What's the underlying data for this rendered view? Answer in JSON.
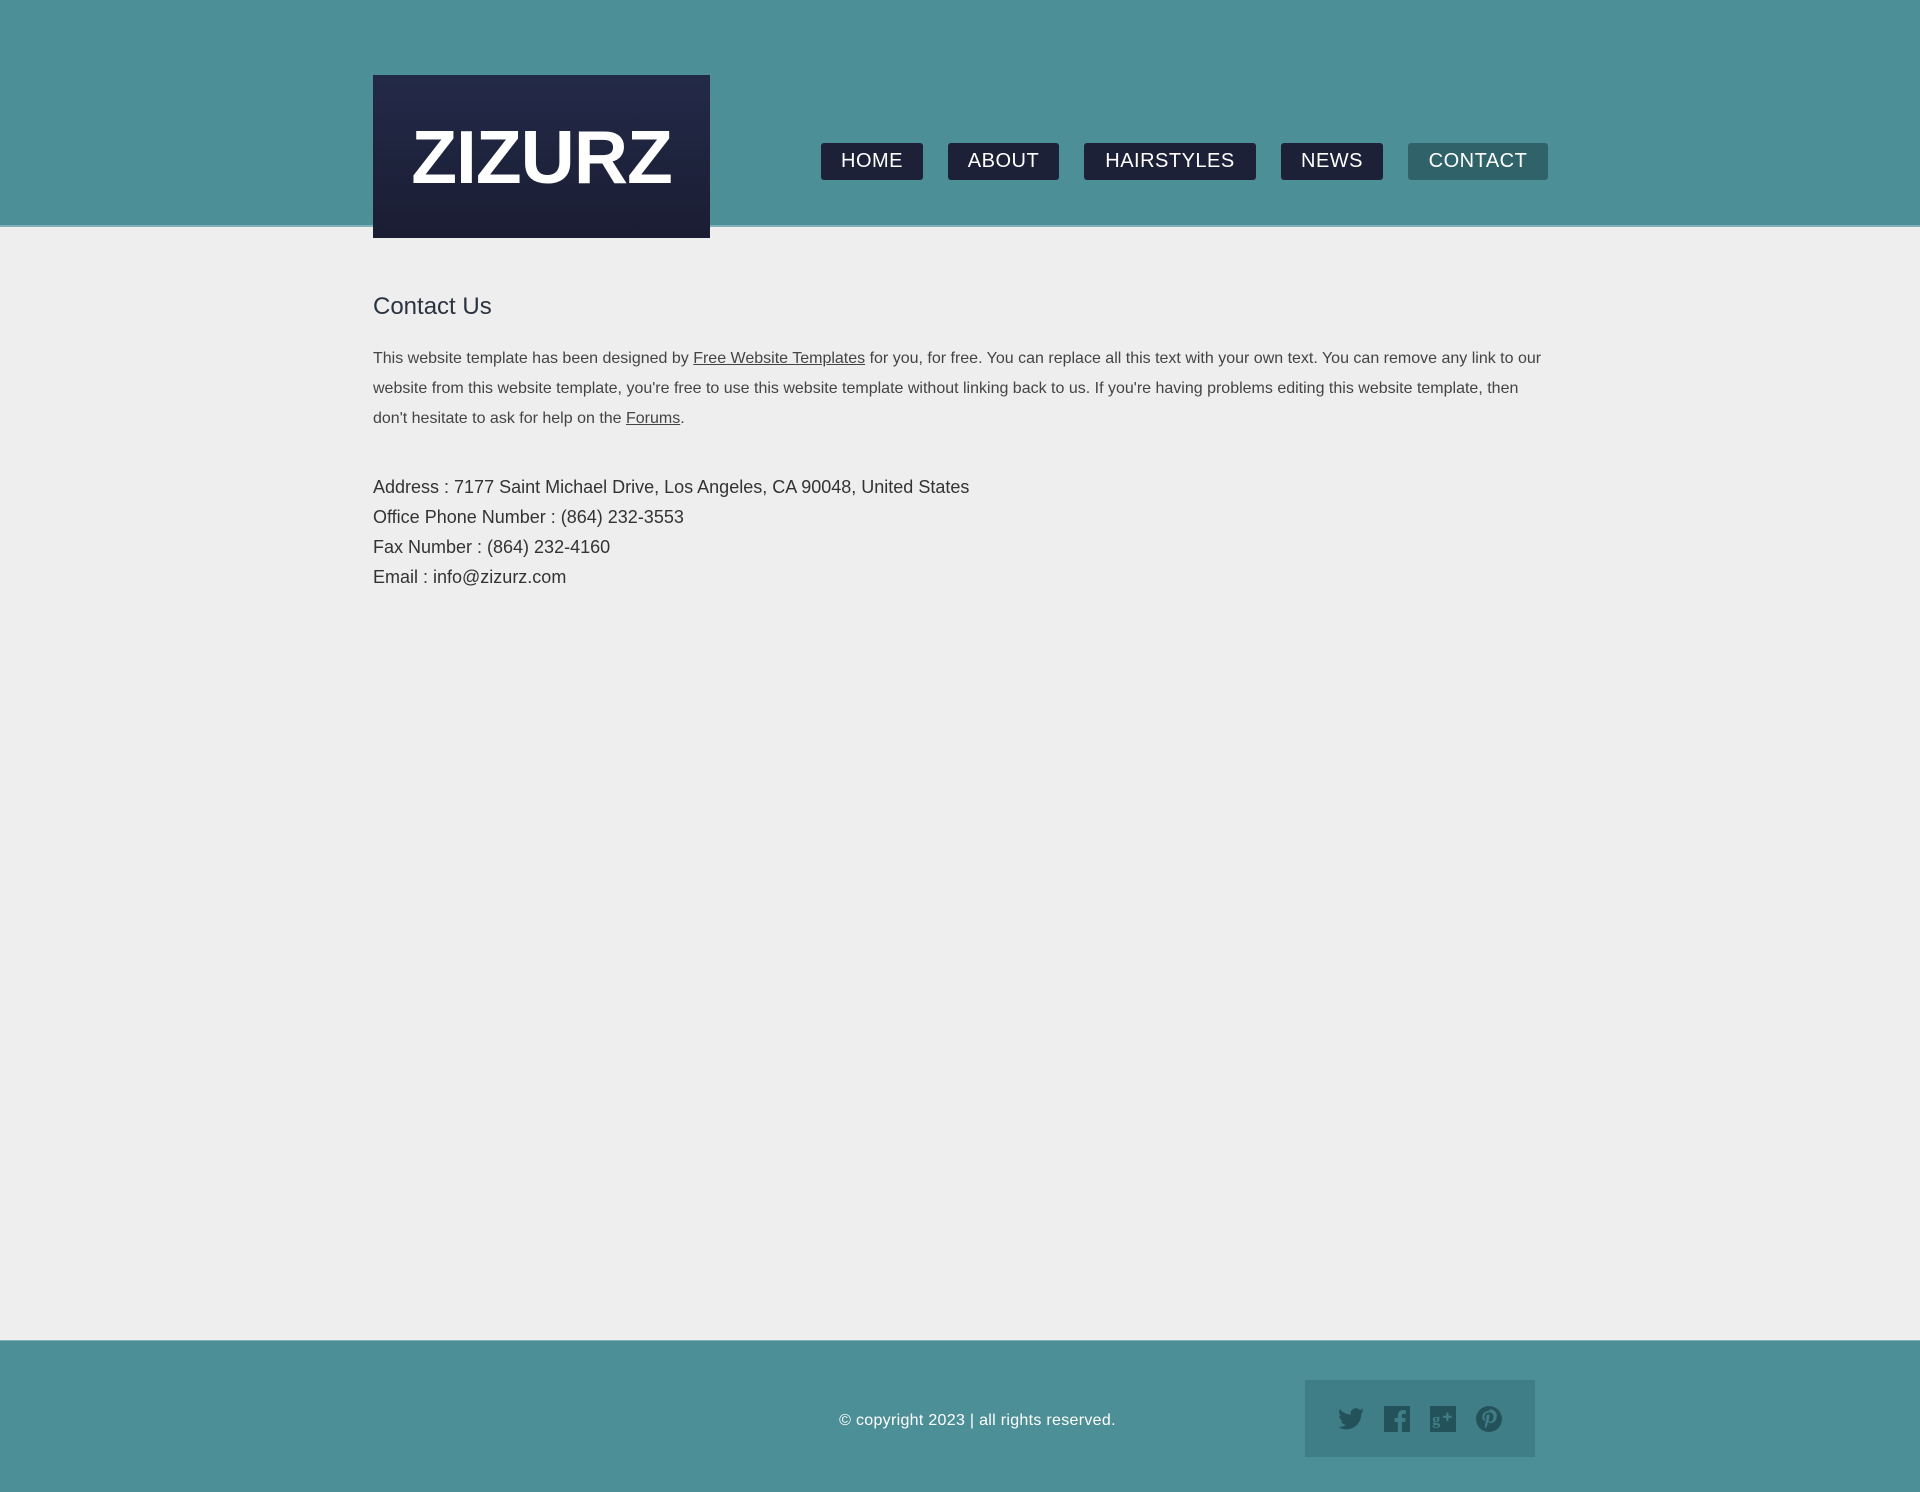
{
  "site": {
    "logo_text": "ZIZURZ"
  },
  "nav": {
    "items": [
      {
        "label": "HOME",
        "active": false
      },
      {
        "label": "ABOUT",
        "active": false
      },
      {
        "label": "HAIRSTYLES",
        "active": false
      },
      {
        "label": "NEWS",
        "active": false
      },
      {
        "label": "CONTACT",
        "active": true
      }
    ]
  },
  "main": {
    "title": "Contact Us",
    "intro": {
      "part1": "This website template has been designed by ",
      "link1": "Free Website Templates",
      "part2": " for you, for free. You can replace all this text with your own text. You can remove any link to our website from this website template, you're free to use this website template without linking back to us. If you're having problems editing this website template, then don't hesitate to ask for help on the ",
      "link2": "Forums",
      "part3": "."
    },
    "details": {
      "address": "Address : 7177 Saint Michael Drive, Los Angeles, CA 90048, United States",
      "phone": "Office Phone Number : (864) 232-3553",
      "fax": "Fax Number : (864) 232-4160",
      "email": "Email : info@zizurz.com"
    }
  },
  "footer": {
    "copyright": "© copyright 2023 | all rights reserved.",
    "social": [
      "twitter-icon",
      "facebook-icon",
      "google-plus-icon",
      "pinterest-icon"
    ]
  },
  "colors": {
    "header_bg": "#4c8f97",
    "logo_bg": "#1c2137",
    "nav_bg": "#1c2137",
    "nav_active_bg": "#2f6369",
    "page_bg": "#eeeeee",
    "social_icon": "#24525a"
  }
}
